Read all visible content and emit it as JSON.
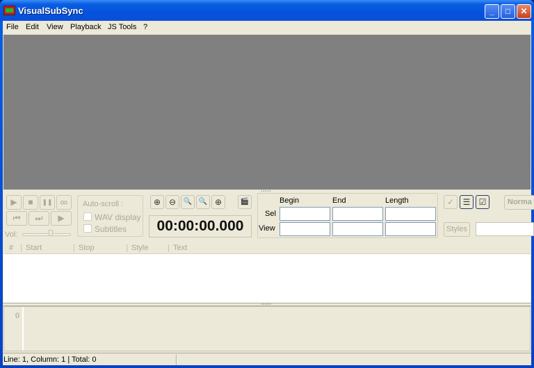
{
  "window": {
    "title": "VisualSubSync",
    "minimize_glyph": "_",
    "maximize_glyph": "□",
    "close_glyph": "✕"
  },
  "menu": [
    "File",
    "Edit",
    "View",
    "Playback",
    "JS Tools",
    "?"
  ],
  "playback": {
    "play_glyph": "▶",
    "stop_glyph": "■",
    "pause_glyph": "❚❚",
    "loop_glyph": "∞",
    "prev_glyph": "⏮",
    "next_glyph": "⏭",
    "play_to_end_glyph": "▶",
    "volume_label": "Vol:",
    "volume_level_percent": 60
  },
  "autoscroll": {
    "title": "Auto-scroll :",
    "wav_display_label": "WAV display",
    "subtitles_label": "Subtitles",
    "wav_display_checked": false,
    "subtitles_checked": false
  },
  "zoom_tools": {
    "zoom_in_glyph": "⊕",
    "zoom_out_glyph": "⊖",
    "zoom_selection_glyph": "🔍",
    "zoom_all_glyph": "🔍",
    "zoom_vertical_glyph": "⊕",
    "clapper_glyph": "🎬"
  },
  "time_display": "00:00:00.000",
  "range": {
    "headers": [
      "Begin",
      "End",
      "Length"
    ],
    "rows": [
      {
        "label": "Sel",
        "values": [
          "",
          "",
          ""
        ]
      },
      {
        "label": "View",
        "values": [
          "",
          "",
          ""
        ]
      }
    ]
  },
  "right_tools": {
    "check_glyph": "✓",
    "doc_glyph": "☰",
    "checklist_glyph": "☑",
    "mode_label": "Norma",
    "styles_label": "Styles",
    "style_select_value": ""
  },
  "subtitle_list": {
    "columns": [
      "#",
      "Start",
      "Stop",
      "Style",
      "Text"
    ],
    "rows": []
  },
  "editor": {
    "line_number": "0",
    "content": ""
  },
  "status": {
    "text": "Line: 1, Column: 1 | Total: 0",
    "secondary": ""
  }
}
